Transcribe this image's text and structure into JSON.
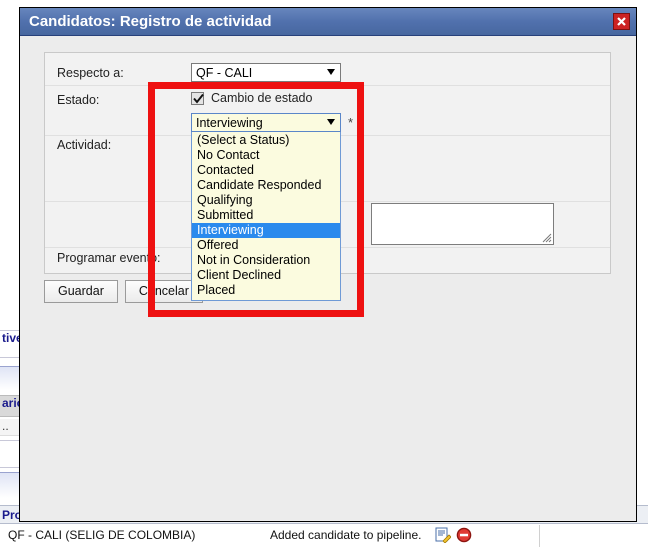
{
  "background": {
    "rows": [
      {
        "text": "tive",
        "kind": "white"
      },
      {
        "text": "",
        "kind": "grad"
      },
      {
        "text": "ario",
        "kind": "grey"
      },
      {
        "text": "..",
        "kind": "plain"
      },
      {
        "text": "",
        "kind": "white"
      },
      {
        "text": "",
        "kind": "grad"
      }
    ]
  },
  "status_bar": {
    "header_text": "Pro",
    "row": {
      "name": "QF - CALI (SELIG DE COLOMBIA)",
      "message": "Added candidate to pipeline.",
      "icons": [
        "edit-icon",
        "delete-icon"
      ]
    }
  },
  "dialog": {
    "title": "Candidatos: Registro de actividad",
    "close_label": "x",
    "titlebar_color": "#5171ad",
    "form": {
      "labels": {
        "respecto_a": "Respecto a:",
        "estado": "Estado:",
        "actividad": "Actividad:",
        "programar_evento": "Programar evento:"
      },
      "respecto_a_select": {
        "value": "QF - CALI",
        "arrow": "chevron-down-icon"
      },
      "cambio_de_estado": {
        "label": "Cambio de estado",
        "checked": true
      },
      "estado_select": {
        "value": "Interviewing",
        "required_marker": "*",
        "arrow": "chevron-down-icon",
        "open": true,
        "highlight_color": "#2a8aed",
        "background_color": "#fbfbdf",
        "options": [
          "(Select a Status)",
          "No Contact",
          "Contacted",
          "Candidate Responded",
          "Qualifying",
          "Submitted",
          "Interviewing",
          "Offered",
          "Not in Consideration",
          "Client Declined",
          "Placed"
        ],
        "selected_index": 6
      },
      "actividad_textarea": {
        "value": "",
        "placeholder": ""
      }
    },
    "buttons": {
      "save": "Guardar",
      "cancel": "Cancelar"
    }
  },
  "annotation": {
    "color": "#ee1111"
  }
}
